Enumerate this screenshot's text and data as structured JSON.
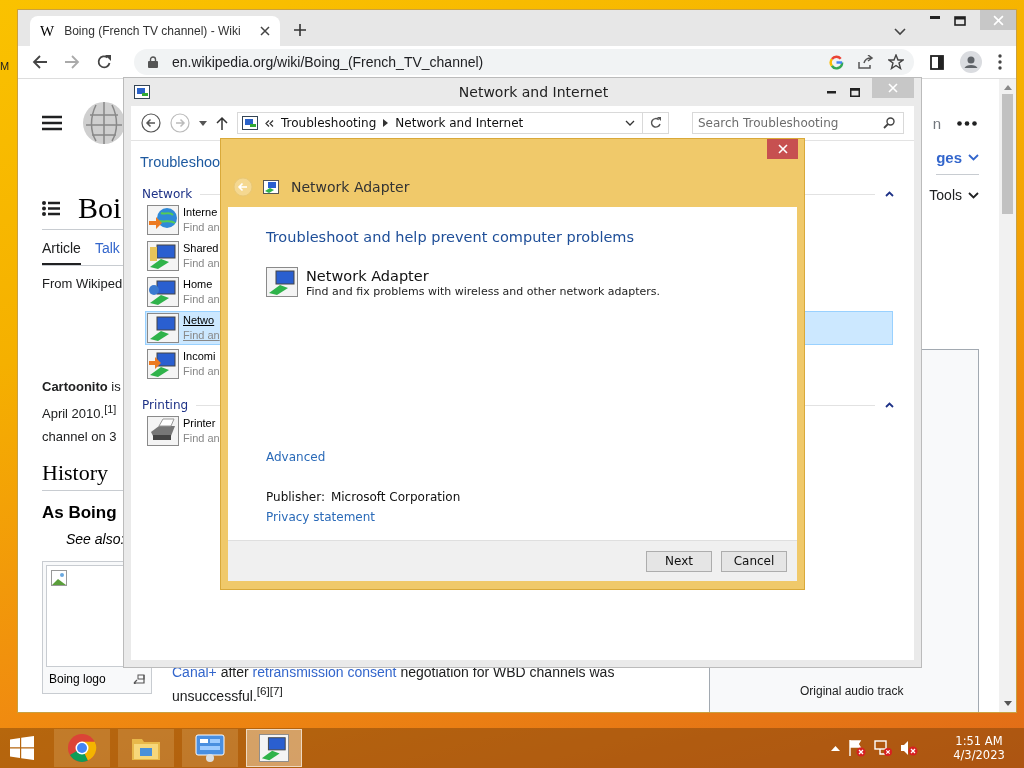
{
  "desktop": {
    "icon_label": "M"
  },
  "browser": {
    "favicon": "W",
    "tab_title": "Boing (French TV channel) - Wiki",
    "url": "en.wikipedia.org/wiki/Boing_(French_TV_channel)"
  },
  "wiki": {
    "search_fragment": "n",
    "title": "Boi",
    "tabs": [
      {
        "label": "Article",
        "selected": true
      },
      {
        "label": "Talk",
        "selected": false
      }
    ],
    "from": "From Wikiped",
    "lines": [
      "**Cartoonito** is",
      "April 2010.$^{[1]}$",
      "channel on 3"
    ],
    "history": "History",
    "subheading": "As Boing",
    "see_also": "See also:",
    "image_caption": "Boing logo",
    "paragraph": [
      {
        "text": "Canal+",
        "link": true
      },
      {
        "text": " after ",
        "link": false
      },
      {
        "text": "retransmission consent",
        "link": true
      },
      {
        "text": " negotiation for WBD channels was unsuccessful.$^{[6][7]}$",
        "link": false
      }
    ],
    "languages": "ges",
    "tools": "Tools",
    "infobox_value": "Original audio track"
  },
  "explorer": {
    "title": "Network and Internet",
    "breadcrumb": [
      "Troubleshooting",
      "Network and Internet"
    ],
    "search": {
      "placeholder": "Search Troubleshooting"
    },
    "heading": "Troubleshoo",
    "groups": [
      {
        "name": "Network",
        "items": [
          {
            "title": "Interne",
            "desc": "Find an",
            "selected": false
          },
          {
            "title": "Shared",
            "desc": "Find an",
            "selected": false
          },
          {
            "title": "Home",
            "desc": "Find an",
            "selected": false
          },
          {
            "title": "Netwo",
            "desc": "Find an",
            "selected": true
          },
          {
            "title": "Incomi",
            "desc": "Find an",
            "selected": false
          }
        ]
      },
      {
        "name": "Printing",
        "items": [
          {
            "title": "Printer",
            "desc": "Find an",
            "selected": false
          }
        ]
      }
    ]
  },
  "dialog": {
    "title": "Network Adapter",
    "heading": "Troubleshoot and help prevent computer problems",
    "item_title": "Network Adapter",
    "item_desc": "Find and fix problems with wireless and other network adapters.",
    "advanced": "Advanced",
    "publisher_label": "Publisher:",
    "publisher": "Microsoft Corporation",
    "privacy": "Privacy statement",
    "buttons": [
      "Next",
      "Cancel"
    ]
  },
  "taskbar": {
    "apps": [
      {
        "kind": "chrome",
        "selected": false
      },
      {
        "kind": "files",
        "selected": false
      },
      {
        "kind": "control",
        "selected": false
      },
      {
        "kind": "adapter",
        "selected": true
      }
    ],
    "time": "1:51 AM",
    "date": "4/3/2023"
  }
}
